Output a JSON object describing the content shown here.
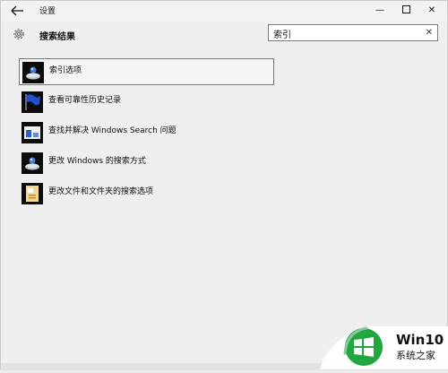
{
  "window": {
    "title": "设置",
    "controls": {
      "minimize": "—",
      "maximize": "",
      "close": "✕"
    }
  },
  "header": {
    "page_title": "搜索结果"
  },
  "search": {
    "value": "索引",
    "clear_label": "✕"
  },
  "results": [
    {
      "label": "索引选项",
      "icon": "indexing-options-icon",
      "selected": true
    },
    {
      "label": "查看可靠性历史记录",
      "icon": "reliability-flag-icon",
      "selected": false
    },
    {
      "label": "查找并解决 Windows Search 问题",
      "icon": "troubleshoot-icon",
      "selected": false
    },
    {
      "label": "更改 Windows 的搜索方式",
      "icon": "indexing-options-icon",
      "selected": false
    },
    {
      "label": "更改文件和文件夹的搜索选项",
      "icon": "folder-options-icon",
      "selected": false
    }
  ],
  "watermark": {
    "brand": "Win10",
    "subtitle": "系统之家"
  },
  "colors": {
    "background": "#efefef",
    "windows_logo_green": "#22a640",
    "item_border": "#777777"
  }
}
